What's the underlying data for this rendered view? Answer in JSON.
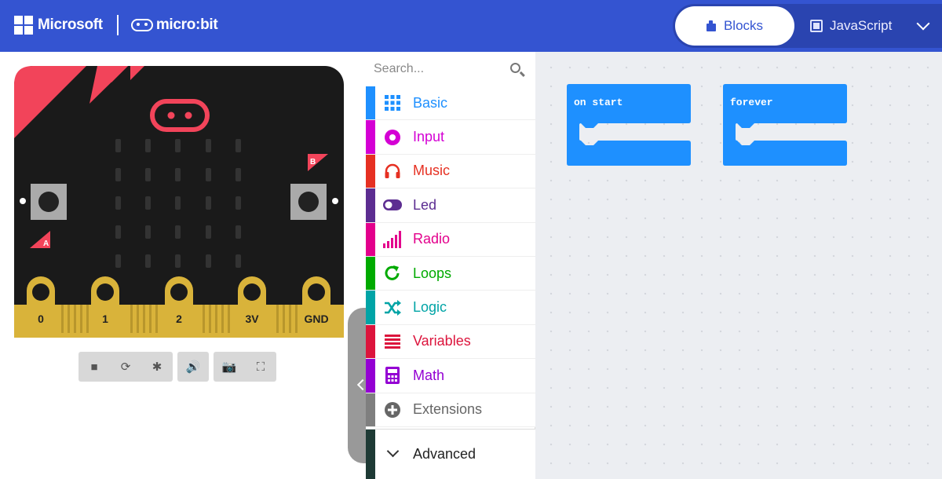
{
  "header": {
    "brand": "Microsoft",
    "product": "micro:bit",
    "tabs": [
      {
        "label": "Blocks",
        "icon": "puzzle-icon",
        "active": true
      },
      {
        "label": "JavaScript",
        "icon": "code-icon",
        "active": false
      }
    ],
    "menu_icon": "chevron-down-icon",
    "colors": {
      "header_bg": "#3454d1"
    }
  },
  "simulator": {
    "pins": [
      "0",
      "1",
      "2",
      "3V",
      "GND"
    ],
    "button_a": "A",
    "button_b": "B",
    "controls": [
      {
        "icon": "stop-icon",
        "glyph": "■"
      },
      {
        "icon": "restart-icon",
        "glyph": "⟳"
      },
      {
        "icon": "debug-icon",
        "glyph": "✱"
      },
      {
        "icon": "sound-icon",
        "glyph": "🔊"
      },
      {
        "icon": "screenshot-icon",
        "glyph": "📷"
      },
      {
        "icon": "fullscreen-icon",
        "glyph": "⛶"
      }
    ]
  },
  "toolbox": {
    "search_placeholder": "Search...",
    "categories": [
      {
        "label": "Basic",
        "color": "#1e90ff",
        "icon": "grid-icon"
      },
      {
        "label": "Input",
        "color": "#d400d4",
        "icon": "circle-icon"
      },
      {
        "label": "Music",
        "color": "#e63022",
        "icon": "headphones-icon"
      },
      {
        "label": "Led",
        "color": "#5c2d91",
        "icon": "toggle-icon"
      },
      {
        "label": "Radio",
        "color": "#e3008c",
        "icon": "signal-icon"
      },
      {
        "label": "Loops",
        "color": "#00aa00",
        "icon": "loop-icon"
      },
      {
        "label": "Logic",
        "color": "#00a4a6",
        "icon": "shuffle-icon"
      },
      {
        "label": "Variables",
        "color": "#dc143c",
        "icon": "list-icon"
      },
      {
        "label": "Math",
        "color": "#9400d3",
        "icon": "calculator-icon"
      },
      {
        "label": "Extensions",
        "color": "#7f7f7f",
        "icon": "plus-circle-icon"
      }
    ],
    "advanced": {
      "label": "Advanced",
      "color": "#1e3a35",
      "icon": "chevron-down-icon"
    }
  },
  "workspace": {
    "blocks": [
      {
        "label": "on start",
        "color": "#1e90ff"
      },
      {
        "label": "forever",
        "color": "#1e90ff"
      }
    ]
  }
}
